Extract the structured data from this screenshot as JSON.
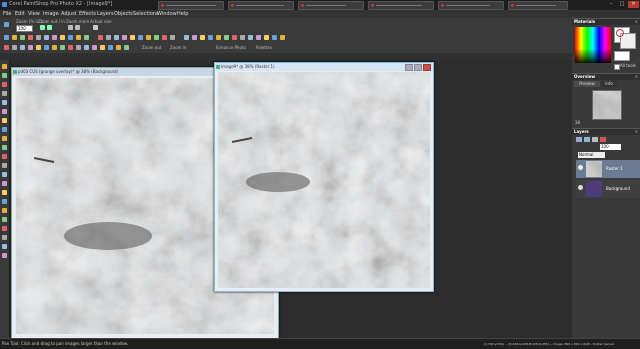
{
  "window": {
    "title": "Corel PaintShop Pro Photo X2 - [Image9*]",
    "minimize": "–",
    "maximize": "□",
    "close": "✕"
  },
  "menu": [
    "File",
    "Edit",
    "View",
    "Image",
    "Adjust",
    "Effects",
    "Layers",
    "Objects",
    "Selections",
    "Window",
    "Help"
  ],
  "toolbar1": {
    "labels": [
      "Zoom (% is 1:",
      "Zoom out / in",
      "Zoom more",
      "Actual size"
    ],
    "zoom_value": "100"
  },
  "toolbar2": {
    "zoom_out": "Zoom out",
    "zoom_in": "Zoom in",
    "enhance_photo": "Enhance Photo",
    "palettes": "Palettes"
  },
  "documents": [
    {
      "title": "pd03 CUS (grunge overlay)* @ 38% (Background)"
    },
    {
      "title": "Image9* @ 38% (Raster 1)"
    }
  ],
  "panels": {
    "materials": {
      "title": "Materials",
      "all_tools": "All tools"
    },
    "overview": {
      "title": "Overview",
      "tabs": [
        "Preview",
        "Info"
      ],
      "zoom": "38"
    },
    "layers": {
      "title": "Layers",
      "blend_mode": "Normal",
      "opacity": "100",
      "items": [
        {
          "name": "Raster 1"
        },
        {
          "name": "Background"
        }
      ]
    }
  },
  "status": {
    "left": "Pan Tool: Click and drag to pan images larger than the window.",
    "coords": "(x:799 y:530) -- (R:228,G:228,B:228,O:255) -- Image:  800 x 800 x RGB - 8 bits/channel"
  },
  "colors": {
    "accent": "#4a8fd9",
    "layer_background_swatch": "#4e3b7c",
    "close": "#b53b2f"
  }
}
